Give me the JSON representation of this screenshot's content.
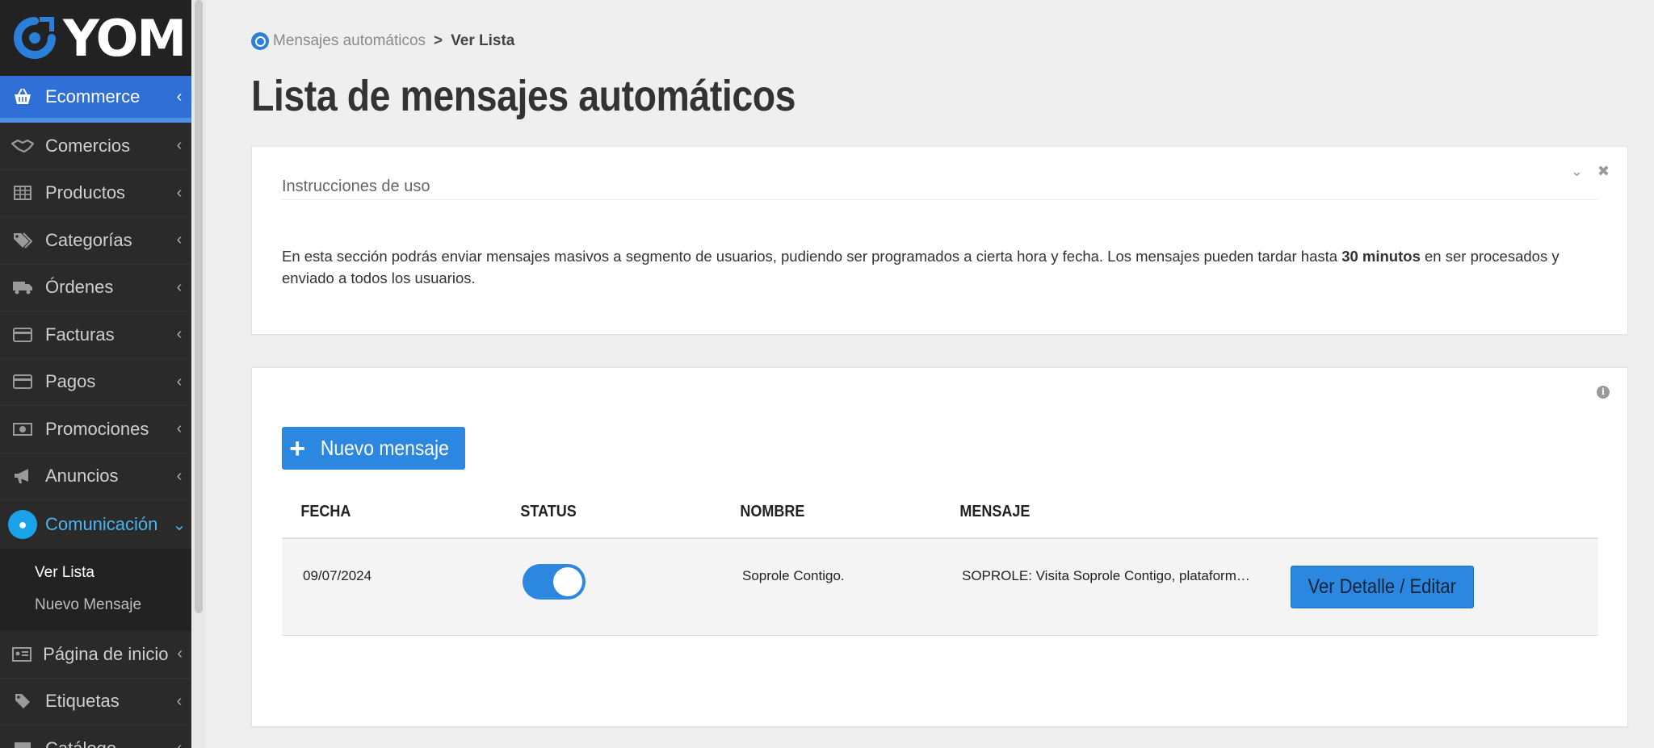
{
  "brand": {
    "name": "YOM"
  },
  "sidebar": {
    "active": {
      "label": "Ecommerce",
      "icon": "basket-icon"
    },
    "items": [
      {
        "label": "Comercios",
        "icon": "handshake-icon"
      },
      {
        "label": "Productos",
        "icon": "table-icon"
      },
      {
        "label": "Categorías",
        "icon": "tags-icon"
      },
      {
        "label": "Órdenes",
        "icon": "truck-icon"
      },
      {
        "label": "Facturas",
        "icon": "credit-card-icon"
      },
      {
        "label": "Pagos",
        "icon": "credit-card-icon"
      },
      {
        "label": "Promociones",
        "icon": "money-icon"
      },
      {
        "label": "Anuncios",
        "icon": "bullhorn-icon"
      }
    ],
    "open": {
      "label": "Comunicación",
      "icon": "chat-icon"
    },
    "sub_items": [
      {
        "label": "Ver Lista",
        "active": true
      },
      {
        "label": "Nuevo Mensaje",
        "active": false
      }
    ],
    "items_after": [
      {
        "label": "Página de inicio",
        "icon": "id-card-icon"
      },
      {
        "label": "Etiquetas",
        "icon": "tag-icon"
      },
      {
        "label": "Catálogo",
        "icon": "book-icon"
      }
    ]
  },
  "breadcrumb": {
    "parent": "Mensajes automáticos",
    "separator": ">",
    "current": "Ver Lista"
  },
  "page_title": "Lista de mensajes automáticos",
  "instructions": {
    "heading": "Instrucciones de uso",
    "text_before": "En esta sección podrás enviar mensajes masivos a segmento de usuarios, pudiendo ser programados a cierta hora y fecha. Los mensajes pueden tardar hasta ",
    "text_bold": "30 minutos",
    "text_after": " en ser procesados y enviado a todos los usuarios."
  },
  "list": {
    "new_button": "Nuevo mensaje",
    "columns": [
      "FECHA",
      "STATUS",
      "NOMBRE",
      "MENSAJE"
    ],
    "rows": [
      {
        "fecha": "09/07/2024",
        "status_on": true,
        "nombre": "Soprole Contigo.",
        "mensaje": "SOPROLE: Visita Soprole Contigo, plataforma di…",
        "action": "Ver Detalle / Editar"
      }
    ]
  },
  "colors": {
    "sidebar_bg": "#2a2a2a",
    "active_blue": "#2f6fd6",
    "button_blue": "#2b87e0",
    "communication_cyan": "#1aa3e8"
  }
}
